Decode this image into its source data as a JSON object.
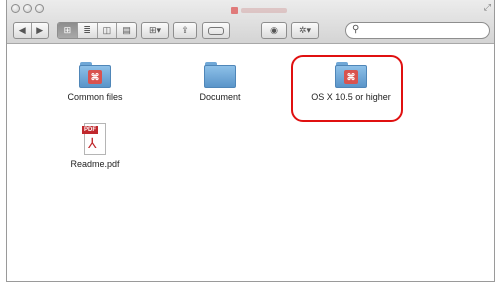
{
  "window": {
    "title": "",
    "accent_color": "#e01010"
  },
  "toolbar": {
    "back_icon": "chevron-left-icon",
    "forward_icon": "chevron-right-icon",
    "view_modes": [
      "icon-view-icon",
      "list-view-icon",
      "column-view-icon",
      "coverflow-view-icon"
    ],
    "arrange_icon": "arrange-grid-icon",
    "share_icon": "share-icon",
    "tag_icon": "tag-icon",
    "quicklook_icon": "eye-icon",
    "action_icon": "gear-icon",
    "search": {
      "placeholder": "",
      "icon": "search-icon"
    }
  },
  "files": [
    {
      "label": "Common files",
      "type": "folder-with-badge"
    },
    {
      "label": "Document",
      "type": "folder"
    },
    {
      "label": "OS X 10.5 or higher",
      "type": "folder-with-badge",
      "highlighted": true
    },
    {
      "label": "Readme.pdf",
      "type": "pdf",
      "tag_text": "PDF"
    }
  ]
}
